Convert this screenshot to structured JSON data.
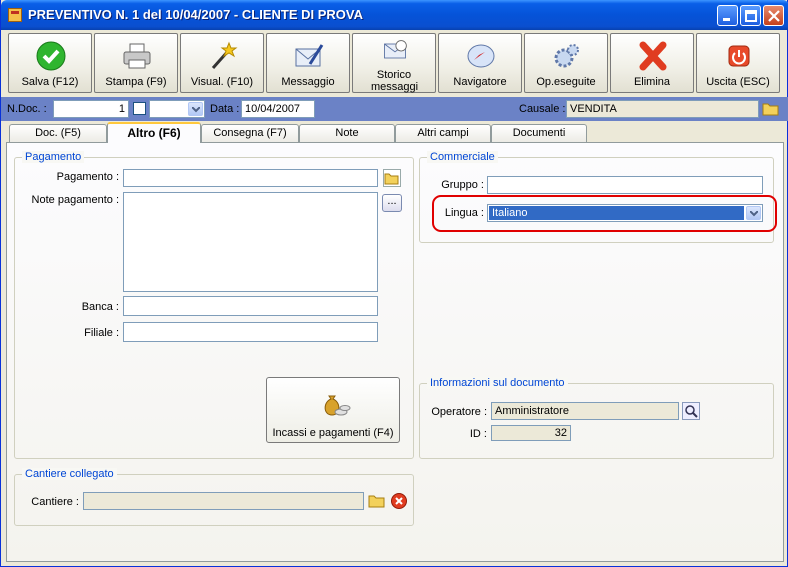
{
  "window": {
    "title": "PREVENTIVO N. 1  del 10/04/2007 - CLIENTE DI PROVA"
  },
  "toolbar": {
    "buttons": [
      {
        "label": "Salva (F12)",
        "icon": "check-icon"
      },
      {
        "label": "Stampa (F9)",
        "icon": "printer-icon"
      },
      {
        "label": "Visual. (F10)",
        "icon": "magic-wand-icon"
      },
      {
        "label": "Messaggio",
        "icon": "envelope-pen-icon"
      },
      {
        "label": "Storico messaggi",
        "icon": "envelope-history-icon"
      },
      {
        "label": "Navigatore",
        "icon": "compass-icon"
      },
      {
        "label": "Op.eseguite",
        "icon": "gears-icon"
      },
      {
        "label": "Elimina",
        "icon": "delete-x-icon"
      },
      {
        "label": "Uscita (ESC)",
        "icon": "power-icon"
      }
    ]
  },
  "header": {
    "ndoc_label": "N.Doc. :",
    "ndoc_value": "1",
    "data_label": "Data :",
    "data_value": "10/04/2007",
    "causale_label": "Causale :",
    "causale_value": "VENDITA"
  },
  "tabs": [
    {
      "label": "Doc. (F5)"
    },
    {
      "label": "Altro (F6)",
      "active": true
    },
    {
      "label": "Consegna (F7)"
    },
    {
      "label": "Note"
    },
    {
      "label": "Altri campi"
    },
    {
      "label": "Documenti"
    }
  ],
  "pagamento": {
    "title": "Pagamento",
    "pagamento_label": "Pagamento :",
    "pagamento_value": "",
    "note_label": "Note pagamento :",
    "note_value": "",
    "note_button": "...",
    "banca_label": "Banca :",
    "banca_value": "",
    "filiale_label": "Filiale :",
    "filiale_value": "",
    "incassi_button": "Incassi e pagamenti (F4)"
  },
  "commerciale": {
    "title": "Commerciale",
    "gruppo_label": "Gruppo :",
    "gruppo_value": "",
    "lingua_label": "Lingua :",
    "lingua_value": "Italiano"
  },
  "informazioni": {
    "title": "Informazioni sul documento",
    "operatore_label": "Operatore :",
    "operatore_value": "Amministratore",
    "id_label": "ID :",
    "id_value": "32"
  },
  "cantiere": {
    "title": "Cantiere collegato",
    "cantiere_label": "Cantiere :",
    "cantiere_value": ""
  },
  "colors": {
    "highlight": "#e00000",
    "accent": "#0046d5",
    "header_bar": "#6b82c6"
  }
}
